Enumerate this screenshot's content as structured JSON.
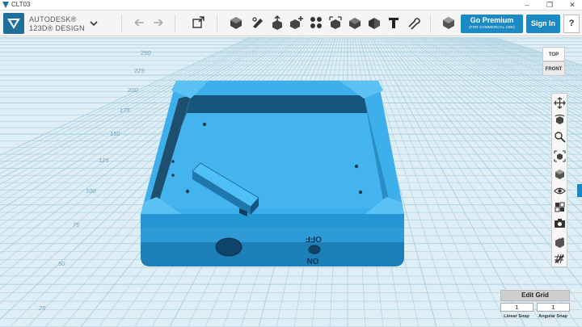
{
  "window": {
    "title": "CLT03",
    "controls": [
      "–",
      "❐",
      "✕"
    ]
  },
  "brand": {
    "line1": "AUTODESK®",
    "line2": "123D® DESIGN"
  },
  "toolbar": {
    "premium_label": "Go Premium",
    "premium_sub": "(FOR COMMERCIAL USE)",
    "signin_label": "Sign In",
    "help_label": "?",
    "tools": [
      "undo-icon",
      "redo-icon",
      "transform-icon",
      "primitives-icon",
      "sketch-icon",
      "construct-icon",
      "modify-icon",
      "pattern-icon",
      "grouping-icon",
      "combine-icon",
      "measure-icon",
      "text-icon",
      "snap-icon",
      "material-icon"
    ]
  },
  "viewcube": {
    "top": "TOP",
    "front": "FRONT"
  },
  "grid_labels": [
    "250",
    "225",
    "200",
    "175",
    "150",
    "125",
    "100",
    "75",
    "50",
    "25"
  ],
  "model_text": {
    "off": "OFF",
    "on": "ON"
  },
  "edit_grid": {
    "title": "Edit Grid",
    "linear_value": "1",
    "angular_value": "1",
    "linear_label": "Linear Snap",
    "angular_label": "Angular Snap"
  },
  "colors": {
    "accent": "#1b8ac4",
    "model": "#2aa3e0",
    "grid": "#dfeef4"
  }
}
